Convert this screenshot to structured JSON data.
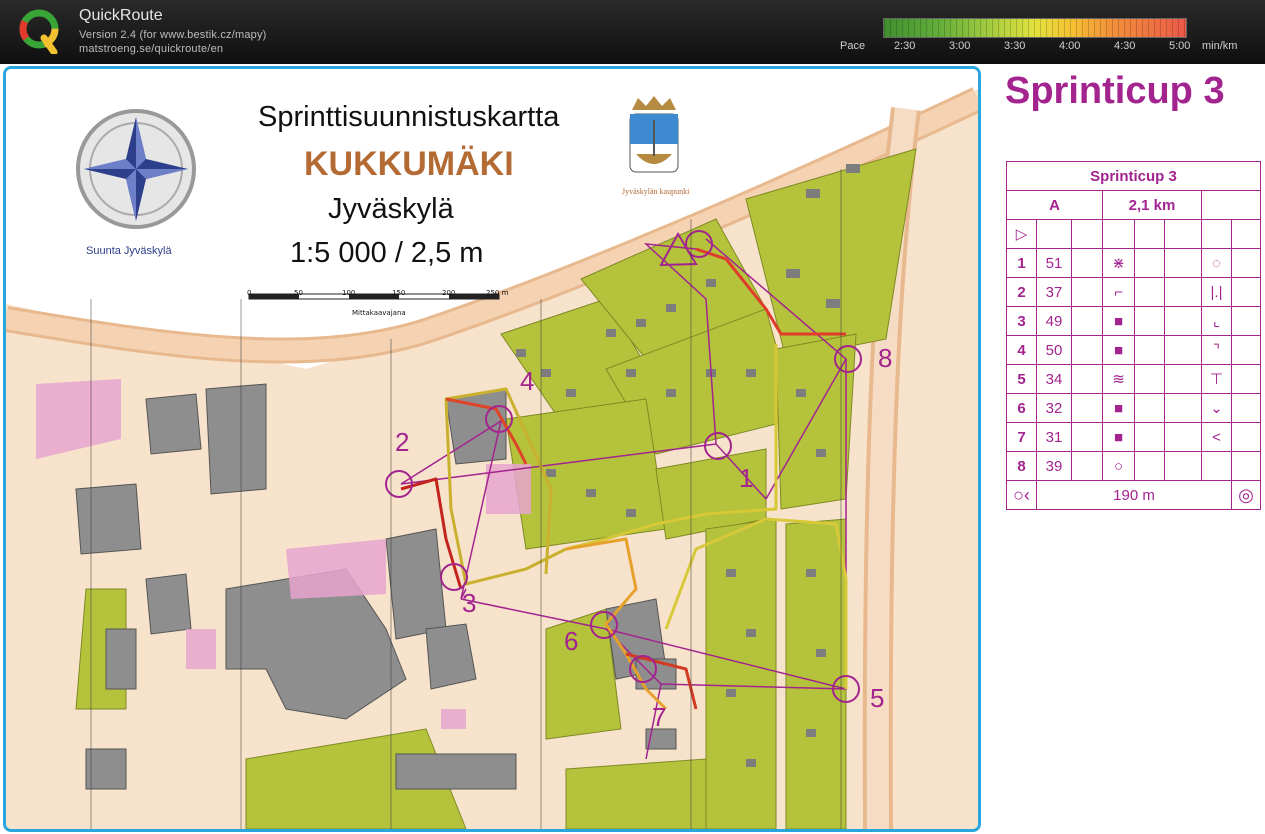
{
  "app": {
    "title": "QuickRoute",
    "version": "Version 2.4  (for www.bestik.cz/mapy)",
    "url": "matstroeng.se/quickroute/en"
  },
  "pace": {
    "label": "Pace",
    "ticks": [
      "2:30",
      "3:00",
      "3:30",
      "4:00",
      "4:30",
      "5:00"
    ],
    "unit": "min/km"
  },
  "map": {
    "title": "Sprinttisuunnistuskartta",
    "name": "KUKKUMÄKI",
    "city": "Jyväskylä",
    "scale": "1:5 000 / 2,5 m",
    "compass_caption": "Suunta Jyväskylä",
    "crest_caption": "Jyväskylän kaupunki",
    "scalebar_ticks": [
      "0",
      "50",
      "100",
      "150",
      "200",
      "250 m"
    ],
    "scalebar_label": "Mittakaavajana",
    "control_numbers": [
      "1",
      "2",
      "3",
      "4",
      "5",
      "6",
      "7",
      "8"
    ]
  },
  "side": {
    "title": "Sprinticup 3"
  },
  "descriptions": {
    "title": "Sprinticup 3",
    "class": "A",
    "length": "2,1 km",
    "start_symbol": "▷",
    "rows": [
      {
        "num": "1",
        "code": "51",
        "feature": "⋇",
        "detail": "◌"
      },
      {
        "num": "2",
        "code": "37",
        "feature": "⌐",
        "detail": "|.|"
      },
      {
        "num": "3",
        "code": "49",
        "feature": "■",
        "detail": "⌞"
      },
      {
        "num": "4",
        "code": "50",
        "feature": "■",
        "detail": "⌝"
      },
      {
        "num": "5",
        "code": "34",
        "feature": "≋",
        "detail": "⊤"
      },
      {
        "num": "6",
        "code": "32",
        "feature": "■",
        "detail": "⌄"
      },
      {
        "num": "7",
        "code": "31",
        "feature": "■",
        "detail": "<"
      },
      {
        "num": "8",
        "code": "39",
        "feature": "○",
        "detail": ""
      }
    ],
    "finish_distance": "190 m"
  },
  "colors": {
    "purple": "#a3238f",
    "frame": "#29a6dc",
    "green": "#b5c23c",
    "building": "#8e8e8e"
  }
}
